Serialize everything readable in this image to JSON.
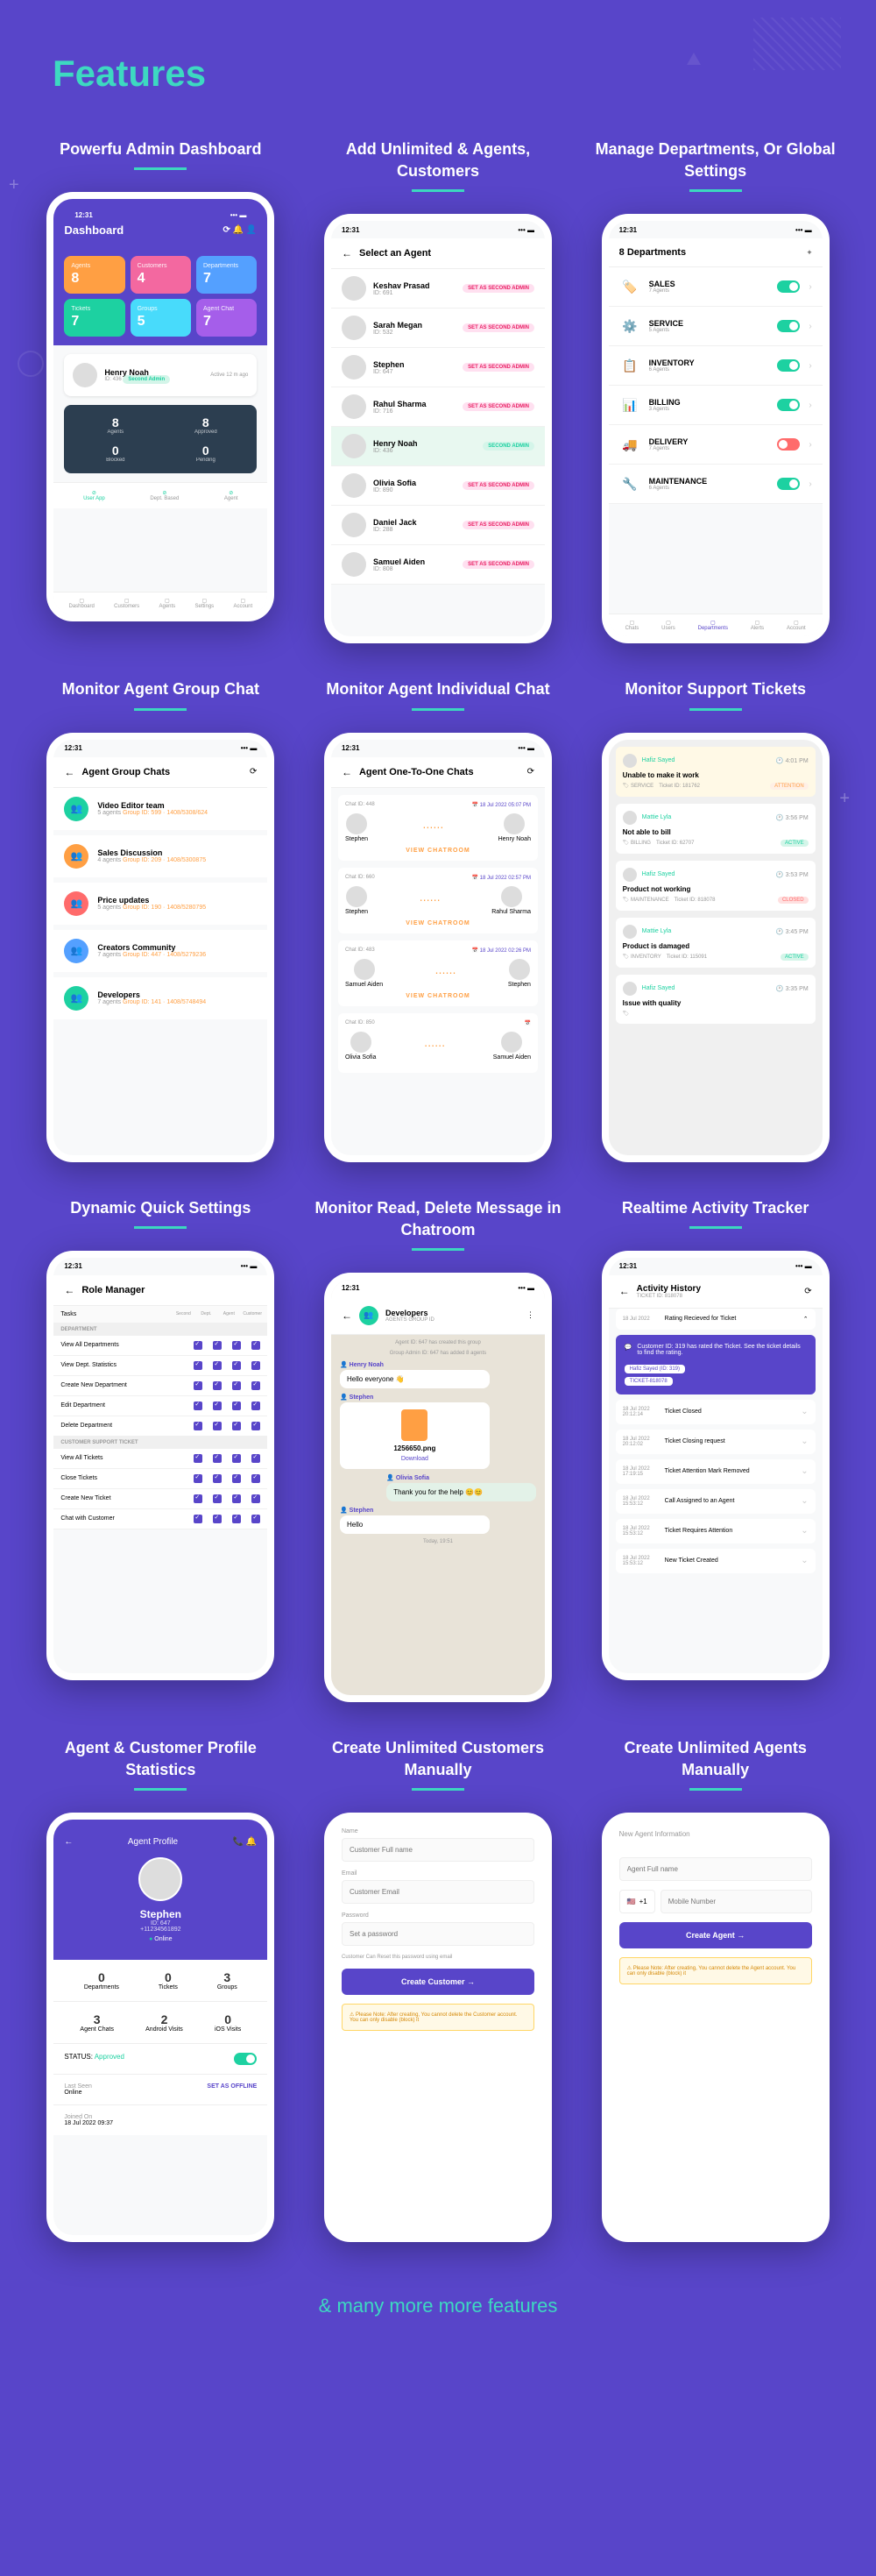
{
  "page_title": "Features",
  "footer": "& many more more features",
  "status_time": "12:31",
  "cells": [
    {
      "title": "Powerfu Admin Dashboard"
    },
    {
      "title": "Add Unlimited & Agents, Customers"
    },
    {
      "title": "Manage Departments, Or Global Settings"
    },
    {
      "title": "Monitor Agent Group Chat"
    },
    {
      "title": "Monitor Agent Individual Chat"
    },
    {
      "title": "Monitor Support Tickets"
    },
    {
      "title": "Dynamic Quick Settings"
    },
    {
      "title": "Monitor Read, Delete Message in Chatroom"
    },
    {
      "title": "Realtime Activity Tracker"
    },
    {
      "title": "Agent & Customer Profile Statistics"
    },
    {
      "title": "Create Unlimited Customers Manually"
    },
    {
      "title": "Create Unlimited Agents Manually"
    }
  ],
  "dashboard": {
    "title": "Dashboard",
    "tiles": [
      {
        "label": "Agents",
        "value": "8",
        "cls": "orange"
      },
      {
        "label": "Customers",
        "value": "4",
        "cls": "pink"
      },
      {
        "label": "Departments",
        "value": "7",
        "cls": "blue"
      },
      {
        "label": "Tickets",
        "value": "7",
        "cls": "green"
      },
      {
        "label": "Groups",
        "value": "5",
        "cls": "cyan"
      },
      {
        "label": "Agent Chat",
        "value": "7",
        "cls": "purple"
      }
    ],
    "profile": {
      "name": "Henry Noah",
      "id": "ID: 436",
      "status": "Second Admin",
      "activity": "Active 12 m ago"
    },
    "dark": [
      {
        "num": "8",
        "label": "Agents"
      },
      {
        "num": "8",
        "label": "Approved"
      },
      {
        "num": "0",
        "label": "Blocked"
      },
      {
        "num": "0",
        "label": "Pending"
      }
    ],
    "nav_tabs": [
      "User App",
      "Dept. Based",
      "Agent"
    ],
    "bottom_nav": [
      "Dashboard",
      "Customers",
      "Agents",
      "Settings",
      "Account"
    ]
  },
  "agents": {
    "header": "Select an Agent",
    "list": [
      {
        "name": "Keshav Prasad",
        "id": "ID: 691",
        "badge": "SET AS SECOND ADMIN"
      },
      {
        "name": "Sarah Megan",
        "id": "ID: 532",
        "badge": "SET AS SECOND ADMIN"
      },
      {
        "name": "Stephen",
        "id": "ID: 647",
        "badge": "SET AS SECOND ADMIN"
      },
      {
        "name": "Rahul Sharma",
        "id": "ID: 716",
        "badge": "SET AS SECOND ADMIN"
      },
      {
        "name": "Henry Noah",
        "id": "ID: 436",
        "badge": "SECOND ADMIN",
        "active": true
      },
      {
        "name": "Olivia Sofia",
        "id": "ID: 890",
        "badge": "SET AS SECOND ADMIN"
      },
      {
        "name": "Daniel Jack",
        "id": "ID: 288",
        "badge": "SET AS SECOND ADMIN"
      },
      {
        "name": "Samuel Aiden",
        "id": "ID: 808",
        "badge": "SET AS SECOND ADMIN"
      }
    ]
  },
  "departments": {
    "header_count": "8 Departments",
    "list": [
      {
        "name": "SALES",
        "sub": "7 Agents",
        "icon": "🏷️",
        "on": true
      },
      {
        "name": "SERVICE",
        "sub": "5 Agents",
        "icon": "⚙️",
        "on": true
      },
      {
        "name": "INVENTORY",
        "sub": "6 Agents",
        "icon": "📋",
        "on": true
      },
      {
        "name": "BILLING",
        "sub": "3 Agents",
        "icon": "📊",
        "on": true
      },
      {
        "name": "DELIVERY",
        "sub": "7 Agents",
        "icon": "🚚",
        "on": false
      },
      {
        "name": "MAINTENANCE",
        "sub": "6 Agents",
        "icon": "🔧",
        "on": true
      }
    ],
    "bottom_nav": [
      "Chats",
      "Users",
      "Departments",
      "Alerts",
      "Account"
    ]
  },
  "groups": {
    "header": "Agent Group Chats",
    "list": [
      {
        "name": "Video Editor team",
        "sub": "5 agents",
        "meta": "Group ID: 599 · 1408/5308/624",
        "color": "#1dd1a1"
      },
      {
        "name": "Sales Discussion",
        "sub": "4 agents",
        "meta": "Group ID: 209 · 1408/5300875",
        "color": "#ff9f43"
      },
      {
        "name": "Price updates",
        "sub": "5 agents",
        "meta": "Group ID: 190 · 1408/5280795",
        "color": "#ff6b6b"
      },
      {
        "name": "Creators Community",
        "sub": "7 agents",
        "meta": "Group ID: 447 · 1408/5279236",
        "color": "#54a0ff"
      },
      {
        "name": "Developers",
        "sub": "7 agents",
        "meta": "Group ID: 141 · 1408/5748494",
        "color": "#1dd1a1"
      }
    ]
  },
  "one2one": {
    "header": "Agent One-To-One Chats",
    "chats": [
      {
        "id": "Chat ID: 448",
        "date": "18 Jul 2022  05:07 PM",
        "user1": "Stephen",
        "user2": "Henry Noah",
        "btn": "VIEW CHATROOM"
      },
      {
        "id": "Chat ID: 660",
        "date": "18 Jul 2022  02:57 PM",
        "user1": "Stephen",
        "user2": "Rahul Sharma",
        "btn": "VIEW CHATROOM"
      },
      {
        "id": "Chat ID: 483",
        "date": "18 Jul 2022  02:26 PM",
        "user1": "Samuel Aiden",
        "user2": "Stephen",
        "btn": "VIEW CHATROOM"
      },
      {
        "id": "Chat ID: 850",
        "date": "",
        "user1": "Olivia Sofia",
        "user2": "Samuel Aiden",
        "btn": ""
      }
    ]
  },
  "tickets": {
    "list": [
      {
        "user": "Hafiz Sayed",
        "time": "4:01 PM",
        "title": "Unable to make it work",
        "dept": "SERVICE",
        "tid": "Ticket ID: 181762",
        "badge": "ATTENTION",
        "badge_cls": "att",
        "yellow": true
      },
      {
        "user": "Mattie Lyla",
        "time": "3:56 PM",
        "title": "Not able to bill",
        "dept": "BILLING",
        "tid": "Ticket ID: 62707",
        "badge": "ACTIVE",
        "badge_cls": "act"
      },
      {
        "user": "Hafiz Sayed",
        "time": "3:53 PM",
        "title": "Product not working",
        "dept": "MAINTENANCE",
        "tid": "Ticket ID: 818078",
        "badge": "CLOSED",
        "badge_cls": "closed"
      },
      {
        "user": "Mattie Lyla",
        "time": "3:45 PM",
        "title": "Product is damaged",
        "dept": "INVENTORY",
        "tid": "Ticket ID: 115091",
        "badge": "ACTIVE",
        "badge_cls": "act"
      },
      {
        "user": "Hafiz Sayed",
        "time": "3:35 PM",
        "title": "Issue with quality",
        "dept": "",
        "tid": "",
        "badge": "",
        "badge_cls": ""
      }
    ]
  },
  "roles": {
    "header": "Role Manager",
    "subtitle": "Tasks",
    "cols": [
      "Second Admin",
      "Dept. Manager",
      "Agent",
      "Customer"
    ],
    "sections": [
      {
        "title": "DEPARTMENT",
        "rows": [
          "View All Departments",
          "View Dept. Statistics",
          "Create New Department",
          "Edit Department",
          "Delete Department"
        ]
      },
      {
        "title": "CUSTOMER SUPPORT TICKET",
        "rows": [
          "View All Tickets",
          "Close Tickets",
          "Create New Ticket",
          "Chat with Customer"
        ]
      }
    ]
  },
  "chatroom": {
    "header": "Developers",
    "sub": "AGENTS GROUP ID",
    "sys1": "Agent ID: 647 has created this group",
    "sys2": "Group Admin ID: 647 has added 8 agents",
    "msgs": [
      {
        "sender": "Henry Noah",
        "text": "Hello everyone 👋",
        "right": false
      },
      {
        "sender": "Stephen",
        "file": "1256650.png",
        "download": "Download",
        "right": false
      },
      {
        "sender": "Olivia Sofia",
        "text": "Thank you for the help 😊😊",
        "right": true
      },
      {
        "sender": "Stephen",
        "text": "Hello",
        "right": false
      }
    ],
    "timestamp": "Today, 19:51"
  },
  "activity": {
    "header": "Activity History",
    "sub": "TICKET ID: 818078",
    "expanded": {
      "title": "Rating Recieved for Ticket",
      "cta_text": "Customer ID: 319 has rated the Ticket. See the ticket details to find the rating.",
      "chips": [
        "Hafiz Sayed (ID: 319)",
        "TICKET-818078"
      ]
    },
    "items": [
      {
        "date": "18 Jul 2022",
        "time": "20:12:14",
        "title": "Ticket Closed"
      },
      {
        "date": "18 Jul 2022",
        "time": "20:12:02",
        "title": "Ticket Closing request"
      },
      {
        "date": "18 Jul 2022",
        "time": "17:19:15",
        "title": "Ticket Attention Mark Removed"
      },
      {
        "date": "18 Jul 2022",
        "time": "15:53:12",
        "title": "Call Assigned to an Agent"
      },
      {
        "date": "18 Jul 2022",
        "time": "15:53:12",
        "title": "Ticket Requires Attention"
      },
      {
        "date": "18 Jul 2022",
        "time": "15:53:12",
        "title": "New Ticket Created"
      }
    ]
  },
  "profile": {
    "header": "Agent Profile",
    "name": "Stephen",
    "id": "ID: 647",
    "phone": "+11234561892",
    "status": "Online",
    "stats1": [
      {
        "num": "0",
        "label": "Departments"
      },
      {
        "num": "0",
        "label": "Tickets"
      },
      {
        "num": "3",
        "label": "Groups"
      }
    ],
    "stats2": [
      {
        "num": "3",
        "label": "Agent Chats"
      },
      {
        "num": "2",
        "label": "Android Visits"
      },
      {
        "num": "0",
        "label": "iOS Visits"
      }
    ],
    "status_label": "STATUS:",
    "status_value": "Approved",
    "lastseen_label": "Last Seen",
    "lastseen_value": "Online",
    "set_offline": "SET AS OFFLINE",
    "joined_label": "Joined On",
    "joined_value": "18 Jul 2022  09:37"
  },
  "create_customer": {
    "fields": [
      {
        "label": "Name",
        "placeholder": "Customer Full name"
      },
      {
        "label": "Email",
        "placeholder": "Customer Email"
      },
      {
        "label": "Password",
        "placeholder": "Set a password"
      }
    ],
    "hint": "Customer Can Reset this password using email",
    "btn": "Create Customer",
    "warning": "Please Note: After creating, You cannot delete the Customer account. You can only disable (block) it"
  },
  "create_agent": {
    "section": "New Agent Information",
    "name_placeholder": "Agent Full name",
    "country_code": "+1",
    "phone_placeholder": "Mobile Number",
    "btn": "Create Agent",
    "warning": "Please Note: After creating, You cannot delete the Agent account. You can only disable (block) it"
  }
}
